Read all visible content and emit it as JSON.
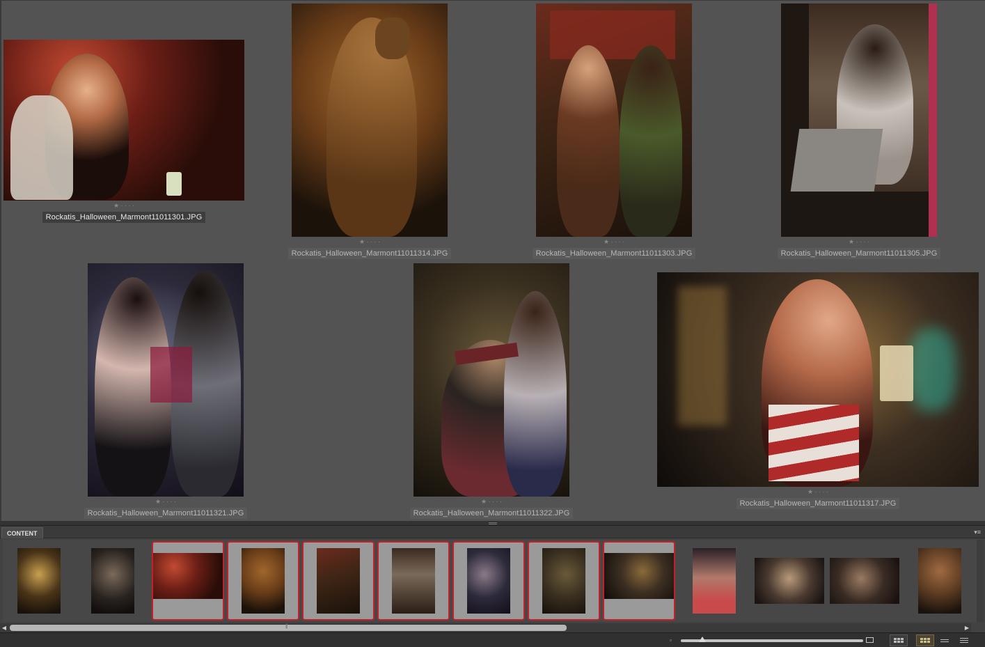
{
  "preview": {
    "photos": [
      {
        "filename": "Rockatis_Halloween_Marmont11011301.JPG",
        "stars": "★ · · · ·",
        "selected": true
      },
      {
        "filename": "Rockatis_Halloween_Marmont11011314.JPG",
        "stars": "★ · · · ·",
        "selected": false
      },
      {
        "filename": "Rockatis_Halloween_Marmont11011303.JPG",
        "stars": "★ · · · ·",
        "selected": false
      },
      {
        "filename": "Rockatis_Halloween_Marmont11011305.JPG",
        "stars": "★ · · · ·",
        "selected": false
      },
      {
        "filename": "Rockatis_Halloween_Marmont11011321.JPG",
        "stars": "★ · · · ·",
        "selected": false
      },
      {
        "filename": "Rockatis_Halloween_Marmont11011322.JPG",
        "stars": "★ · · · ·",
        "selected": false
      },
      {
        "filename": "Rockatis_Halloween_Marmont11011317.JPG",
        "stars": "★ · · · ·",
        "selected": false
      }
    ]
  },
  "content_panel": {
    "tab_label": "CONTENT",
    "menu_icon": "panel-menu-icon",
    "thumbnails_selected": [
      false,
      false,
      true,
      true,
      true,
      true,
      true,
      true,
      true,
      false,
      false,
      false,
      false
    ],
    "scroll_position_fraction": 0.0
  },
  "toolbar": {
    "thumbnail_size_fraction": 0.1,
    "view_modes": [
      "grid-view",
      "filmstrip-view",
      "list-view"
    ],
    "active_view": "filmstrip-view"
  },
  "colors": {
    "selection_border": "#c4202a",
    "preview_bg": "#535353",
    "panel_bg": "#424242"
  }
}
